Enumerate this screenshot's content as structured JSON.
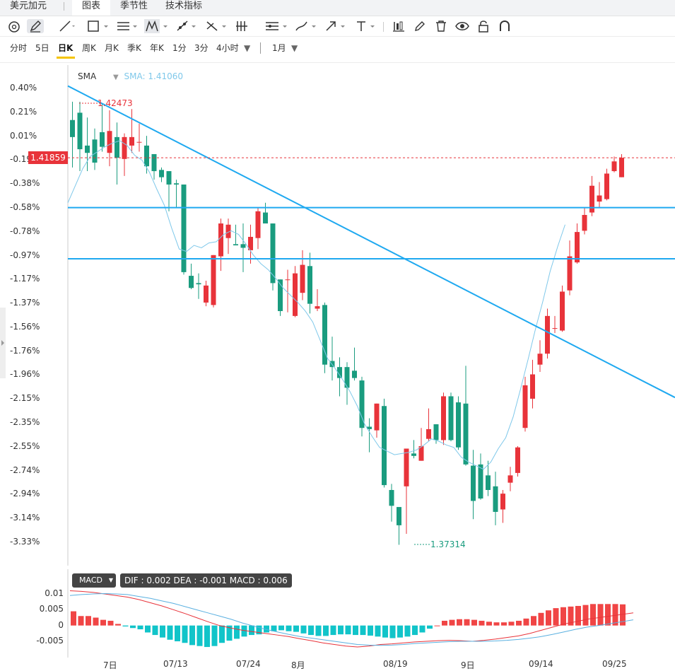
{
  "tabs": {
    "pair": "美元加元",
    "items": [
      "图表",
      "季节性",
      "技术指标"
    ],
    "active": 0
  },
  "toolbar": {
    "icons": [
      "magnet-icon",
      "pencil-icon",
      "line-icon",
      "rectangle-icon",
      "parallel-lines-icon",
      "pattern-icon",
      "measure-icon",
      "fibonacci-icon",
      "gann-icon",
      "levels-icon",
      "brush-icon",
      "arrow-icon",
      "text-icon",
      "bars-style-icon",
      "edit-icon",
      "trash-icon",
      "eye-icon",
      "lock-icon",
      "magnet-u-icon"
    ]
  },
  "periods": {
    "items": [
      "分时",
      "5日",
      "日K",
      "周K",
      "月K",
      "季K",
      "年K",
      "1分",
      "3分",
      "4小时"
    ],
    "active": 2,
    "range": "1月"
  },
  "indicator": {
    "name": "SMA",
    "value_text": "SMA: 1.41060"
  },
  "price": {
    "last": "1.41859",
    "last_label_color": "#e8333a",
    "high": "1.42473",
    "low": "1.37314"
  },
  "yticks": [
    "0.40%",
    "0.21%",
    "0.01%",
    "-0.19%",
    "-0.38%",
    "-0.58%",
    "-0.78%",
    "-0.97%",
    "-1.17%",
    "-1.37%",
    "-1.56%",
    "-1.76%",
    "-1.96%",
    "-2.15%",
    "-2.35%",
    "-2.55%",
    "-2.74%",
    "-2.94%",
    "-3.14%",
    "-3.33%"
  ],
  "macd": {
    "button": "MACD",
    "values": "DIF : 0.002   DEA : -0.001   MACD : 0.006",
    "yticks": [
      "0.01",
      "0.005",
      "0",
      "-0.005"
    ]
  },
  "xlabels": [
    "7日",
    "07/13",
    "07/24",
    "8月",
    "08/19",
    "9日",
    "09/14",
    "09/25"
  ],
  "colors": {
    "up": "#e8333a",
    "down": "#1a9c7f",
    "trend": "#1fa9f0",
    "sma": "#7fc8ea",
    "macd_up": "#f04545",
    "macd_down": "#11c4c9"
  },
  "chart_data": {
    "type": "candlestick",
    "price_range_percent": [
      -3.43,
      0.52
    ],
    "candles": [
      {
        "o": 0.14,
        "c": 0.0,
        "h": 0.29,
        "l": -0.25
      },
      {
        "o": 0.2,
        "c": -0.1,
        "h": 0.29,
        "l": -0.28
      },
      {
        "o": -0.07,
        "c": -0.13,
        "h": 0.16,
        "l": -0.28
      },
      {
        "o": -0.02,
        "c": -0.21,
        "h": 0.07,
        "l": -0.27
      },
      {
        "o": 0.04,
        "c": -0.08,
        "h": 0.27,
        "l": -0.12
      },
      {
        "o": -0.13,
        "c": 0.05,
        "h": 0.22,
        "l": -0.24
      },
      {
        "o": 0.0,
        "c": -0.17,
        "h": 0.12,
        "l": -0.39
      },
      {
        "o": -0.18,
        "c": 0.0,
        "h": 0.03,
        "l": -0.32
      },
      {
        "o": -0.07,
        "c": 0.0,
        "h": 0.23,
        "l": -0.13
      },
      {
        "o": -0.04,
        "c": -0.04,
        "h": 0.11,
        "l": -0.12
      },
      {
        "o": -0.07,
        "c": -0.24,
        "h": 0.01,
        "l": -0.3
      },
      {
        "o": -0.14,
        "c": -0.28,
        "h": -0.14,
        "l": -0.35
      },
      {
        "o": -0.27,
        "c": -0.33,
        "h": -0.25,
        "l": -0.37
      },
      {
        "o": -0.28,
        "c": -0.39,
        "h": -0.28,
        "l": -0.61
      },
      {
        "o": -0.38,
        "c": -0.39,
        "h": -0.35,
        "l": -0.58
      },
      {
        "o": -0.39,
        "c": -1.11,
        "h": -0.39,
        "l": -1.13
      },
      {
        "o": -1.14,
        "c": -1.24,
        "h": -1.04,
        "l": -1.25
      },
      {
        "o": -1.2,
        "c": -1.21,
        "h": -1.12,
        "l": -1.33
      },
      {
        "o": -1.36,
        "c": -1.22,
        "h": -1.18,
        "l": -1.39
      },
      {
        "o": -1.38,
        "c": -0.97,
        "h": -0.97,
        "l": -1.4
      },
      {
        "o": -0.98,
        "c": -0.71,
        "h": -0.67,
        "l": -1.1
      },
      {
        "o": -0.83,
        "c": -0.72,
        "h": -0.67,
        "l": -0.96
      },
      {
        "o": -0.88,
        "c": -0.89,
        "h": -0.72,
        "l": -0.88
      },
      {
        "o": -0.88,
        "c": -0.91,
        "h": -0.71,
        "l": -1.11
      },
      {
        "o": -0.93,
        "c": -0.82,
        "h": -0.72,
        "l": -1.04
      },
      {
        "o": -0.83,
        "c": -0.61,
        "h": -0.58,
        "l": -0.92
      },
      {
        "o": -0.62,
        "c": -0.71,
        "h": -0.54,
        "l": -0.71
      },
      {
        "o": -0.71,
        "c": -1.2,
        "h": -0.71,
        "l": -1.26
      },
      {
        "o": -1.17,
        "c": -1.43,
        "h": -1.17,
        "l": -1.47
      },
      {
        "o": -1.17,
        "c": -1.17,
        "h": -1.09,
        "l": -1.44
      },
      {
        "o": -1.47,
        "c": -1.12,
        "h": -1.06,
        "l": -1.48
      },
      {
        "o": -1.28,
        "c": -1.05,
        "h": -0.93,
        "l": -1.34
      },
      {
        "o": -1.06,
        "c": -1.37,
        "h": -0.95,
        "l": -1.45
      },
      {
        "o": -1.41,
        "c": -1.39,
        "h": -1.25,
        "l": -1.43
      },
      {
        "o": -1.38,
        "c": -1.87,
        "h": -1.36,
        "l": -1.94
      },
      {
        "o": -1.84,
        "c": -1.89,
        "h": -1.64,
        "l": -2.0
      },
      {
        "o": -1.89,
        "c": -1.98,
        "h": -1.81,
        "l": -2.13
      },
      {
        "o": -1.89,
        "c": -2.06,
        "h": -1.85,
        "l": -2.2
      },
      {
        "o": -1.92,
        "c": -1.98,
        "h": -1.73,
        "l": -2.0
      },
      {
        "o": -2.0,
        "c": -2.39,
        "h": -1.97,
        "l": -2.46
      },
      {
        "o": -2.38,
        "c": -2.4,
        "h": -2.31,
        "l": -2.59
      },
      {
        "o": -2.41,
        "c": -2.19,
        "h": -2.19,
        "l": -2.47
      },
      {
        "o": -2.21,
        "c": -2.86,
        "h": -2.15,
        "l": -2.88
      },
      {
        "o": -2.9,
        "c": -3.03,
        "h": -2.85,
        "l": -3.16
      },
      {
        "o": -3.04,
        "c": -3.19,
        "h": -3.04,
        "l": -3.35
      },
      {
        "o": -2.87,
        "c": -2.56,
        "h": -2.56,
        "l": -3.26
      },
      {
        "o": -2.6,
        "c": -2.62,
        "h": -2.49,
        "l": -2.64
      },
      {
        "o": -2.66,
        "c": -2.54,
        "h": -2.39,
        "l": -2.66
      },
      {
        "o": -2.48,
        "c": -2.4,
        "h": -2.23,
        "l": -2.5
      },
      {
        "o": -2.36,
        "c": -2.49,
        "h": -2.36,
        "l": -2.52
      },
      {
        "o": -2.49,
        "c": -2.13,
        "h": -2.1,
        "l": -2.53
      },
      {
        "o": -2.13,
        "c": -2.49,
        "h": -2.1,
        "l": -2.5
      },
      {
        "o": -2.18,
        "c": -2.55,
        "h": -2.13,
        "l": -2.57
      },
      {
        "o": -2.19,
        "c": -2.69,
        "h": -1.88,
        "l": -2.7
      },
      {
        "o": -2.7,
        "c": -2.99,
        "h": -2.57,
        "l": -3.14
      },
      {
        "o": -2.69,
        "c": -2.97,
        "h": -2.6,
        "l": -2.98
      },
      {
        "o": -2.78,
        "c": -2.9,
        "h": -2.66,
        "l": -2.95
      },
      {
        "o": -2.87,
        "c": -3.08,
        "h": -2.75,
        "l": -3.19
      },
      {
        "o": -3.06,
        "c": -2.93,
        "h": -2.9,
        "l": -3.17
      },
      {
        "o": -2.84,
        "c": -2.78,
        "h": -2.71,
        "l": -2.91
      },
      {
        "o": -2.76,
        "c": -2.55,
        "h": -2.54,
        "l": -2.79
      },
      {
        "o": -2.39,
        "c": -2.04,
        "h": -1.97,
        "l": -2.42
      },
      {
        "o": -2.15,
        "c": -1.95,
        "h": -1.83,
        "l": -2.23
      },
      {
        "o": -1.87,
        "c": -1.78,
        "h": -1.67,
        "l": -1.93
      },
      {
        "o": -1.78,
        "c": -1.47,
        "h": -1.41,
        "l": -1.82
      },
      {
        "o": -1.57,
        "c": -1.57,
        "h": -1.47,
        "l": -1.61
      },
      {
        "o": -1.59,
        "c": -1.27,
        "h": -1.22,
        "l": -1.6
      },
      {
        "o": -1.26,
        "c": -0.98,
        "h": -0.85,
        "l": -1.3
      },
      {
        "o": -1.03,
        "c": -0.78,
        "h": -0.71,
        "l": -1.04
      },
      {
        "o": -0.77,
        "c": -0.64,
        "h": -0.58,
        "l": -0.8
      },
      {
        "o": -0.62,
        "c": -0.4,
        "h": -0.32,
        "l": -0.65
      },
      {
        "o": -0.53,
        "c": -0.48,
        "h": -0.37,
        "l": -0.58
      },
      {
        "o": -0.51,
        "c": -0.3,
        "h": -0.26,
        "l": -0.52
      },
      {
        "o": -0.28,
        "c": -0.2,
        "h": -0.16,
        "l": -0.29
      },
      {
        "o": -0.33,
        "c": -0.17,
        "h": -0.14,
        "l": -0.33
      }
    ],
    "sma_percent": [
      -0.54,
      -0.4,
      -0.26,
      -0.16,
      -0.12,
      -0.08,
      -0.05,
      -0.03,
      -0.07,
      -0.15,
      -0.19,
      -0.29,
      -0.43,
      -0.56,
      -0.75,
      -0.92,
      -0.94,
      -0.89,
      -0.91,
      -0.87,
      -0.86,
      -0.8,
      -0.77,
      -0.8,
      -0.88,
      -0.97,
      -1.04,
      -1.09,
      -1.16,
      -1.24,
      -1.3,
      -1.36,
      -1.43,
      -1.52,
      -1.67,
      -1.82,
      -1.9,
      -1.99,
      -2.09,
      -2.21,
      -2.36,
      -2.46,
      -2.55,
      -2.58,
      -2.61,
      -2.6,
      -2.59,
      -2.57,
      -2.53,
      -2.48,
      -2.5,
      -2.53,
      -2.55,
      -2.63,
      -2.67,
      -2.7,
      -2.73,
      -2.67,
      -2.56,
      -2.47,
      -2.3,
      -2.07,
      -1.83,
      -1.58,
      -1.35,
      -1.1,
      -0.9,
      -0.72
    ],
    "trendline_percent": [
      [
        0,
        0.42
      ],
      [
        80,
        -2.14
      ]
    ],
    "horizontal_levels_percent": [
      -0.58,
      -1.0
    ],
    "last_price_level_percent": -0.17,
    "macd_hist": [
      0.0045,
      0.003,
      0.003,
      0.0025,
      0.0018,
      0.0015,
      0.0005,
      -0.0003,
      -0.0008,
      -0.0012,
      -0.0022,
      -0.003,
      -0.0038,
      -0.0045,
      -0.005,
      -0.0055,
      -0.0062,
      -0.0065,
      -0.0068,
      -0.0065,
      -0.0055,
      -0.0048,
      -0.0042,
      -0.0035,
      -0.003,
      -0.0028,
      -0.0022,
      -0.0018,
      -0.0015,
      -0.0018,
      -0.002,
      -0.0025,
      -0.003,
      -0.0033,
      -0.0033,
      -0.003,
      -0.0028,
      -0.0028,
      -0.003,
      -0.003,
      -0.0032,
      -0.0035,
      -0.0038,
      -0.004,
      -0.0038,
      -0.0035,
      -0.003,
      -0.0022,
      -0.001,
      0.0,
      0.0015,
      0.0018,
      0.002,
      0.002,
      0.0018,
      0.0015,
      0.0012,
      0.001,
      0.001,
      0.0012,
      0.0015,
      0.0022,
      0.003,
      0.004,
      0.0048,
      0.0055,
      0.0058,
      0.006,
      0.0062,
      0.0065,
      0.0068,
      0.0068,
      0.0068,
      0.0068,
      0.0067
    ],
    "macd_dif": [
      0.011,
      0.0108,
      0.0105,
      0.01,
      0.0095,
      0.009,
      0.0082,
      0.0072,
      0.0062,
      0.005,
      0.0038,
      0.0025,
      0.0012,
      0.0,
      -0.0008,
      -0.0015,
      -0.002,
      -0.0025,
      -0.003,
      -0.0035,
      -0.0042,
      -0.0048,
      -0.0055,
      -0.006,
      -0.0065,
      -0.0068,
      -0.0065,
      -0.006,
      -0.0058,
      -0.0055,
      -0.0052,
      -0.005,
      -0.0048,
      -0.0047,
      -0.0048,
      -0.005,
      -0.0047,
      -0.0043,
      -0.0038,
      -0.0033,
      -0.0025,
      -0.0015,
      -0.0005,
      0.0005,
      0.0012,
      0.002,
      0.0025,
      0.003,
      0.0035,
      0.004
    ],
    "macd_dea": [
      0.0095,
      0.0098,
      0.01,
      0.0101,
      0.01,
      0.0098,
      0.0092,
      0.0086,
      0.0078,
      0.007,
      0.006,
      0.005,
      0.004,
      0.003,
      0.002,
      0.0008,
      -0.0002,
      -0.0012,
      -0.002,
      -0.0028,
      -0.0035,
      -0.004,
      -0.0045,
      -0.005,
      -0.0055,
      -0.006,
      -0.0062,
      -0.0063,
      -0.0062,
      -0.006,
      -0.0057,
      -0.0055,
      -0.0053,
      -0.0051,
      -0.005,
      -0.005,
      -0.005,
      -0.0049,
      -0.0047,
      -0.0044,
      -0.004,
      -0.0035,
      -0.0028,
      -0.002,
      -0.0012,
      -0.0005,
      0.0,
      0.0006,
      0.0012,
      0.0018
    ],
    "macd_range": [
      -0.0075,
      0.0125
    ]
  }
}
